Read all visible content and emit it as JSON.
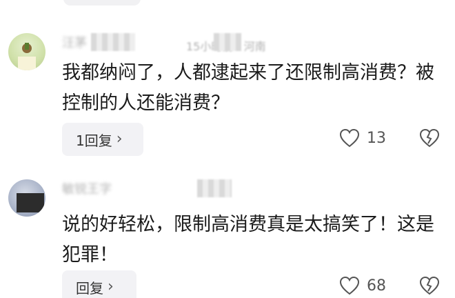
{
  "comments": [
    {
      "username": "汪茅",
      "meta": "15小时前 · 河南",
      "text": "我都纳闷了，人都逮起来了还限制高消费？被控制的人还能消费？",
      "reply_label": "1回复",
      "reply_chevron": "›",
      "likes": "13",
      "avatar_icon": "avatar-image",
      "like_icon": "heart-outline-icon",
      "dislike_icon": "broken-heart-icon"
    },
    {
      "username": "敏锐王字",
      "meta": "",
      "text": "说的好轻松，限制高消费真是太搞笑了！这是犯罪！",
      "reply_label": "回复",
      "reply_chevron": "›",
      "likes": "68",
      "avatar_icon": "avatar-image",
      "like_icon": "heart-outline-icon",
      "dislike_icon": "broken-heart-icon"
    }
  ],
  "colors": {
    "text": "#1b1b1b",
    "muted": "#b3b3b3",
    "button_bg": "#f2f2f5",
    "icon": "#555555"
  }
}
